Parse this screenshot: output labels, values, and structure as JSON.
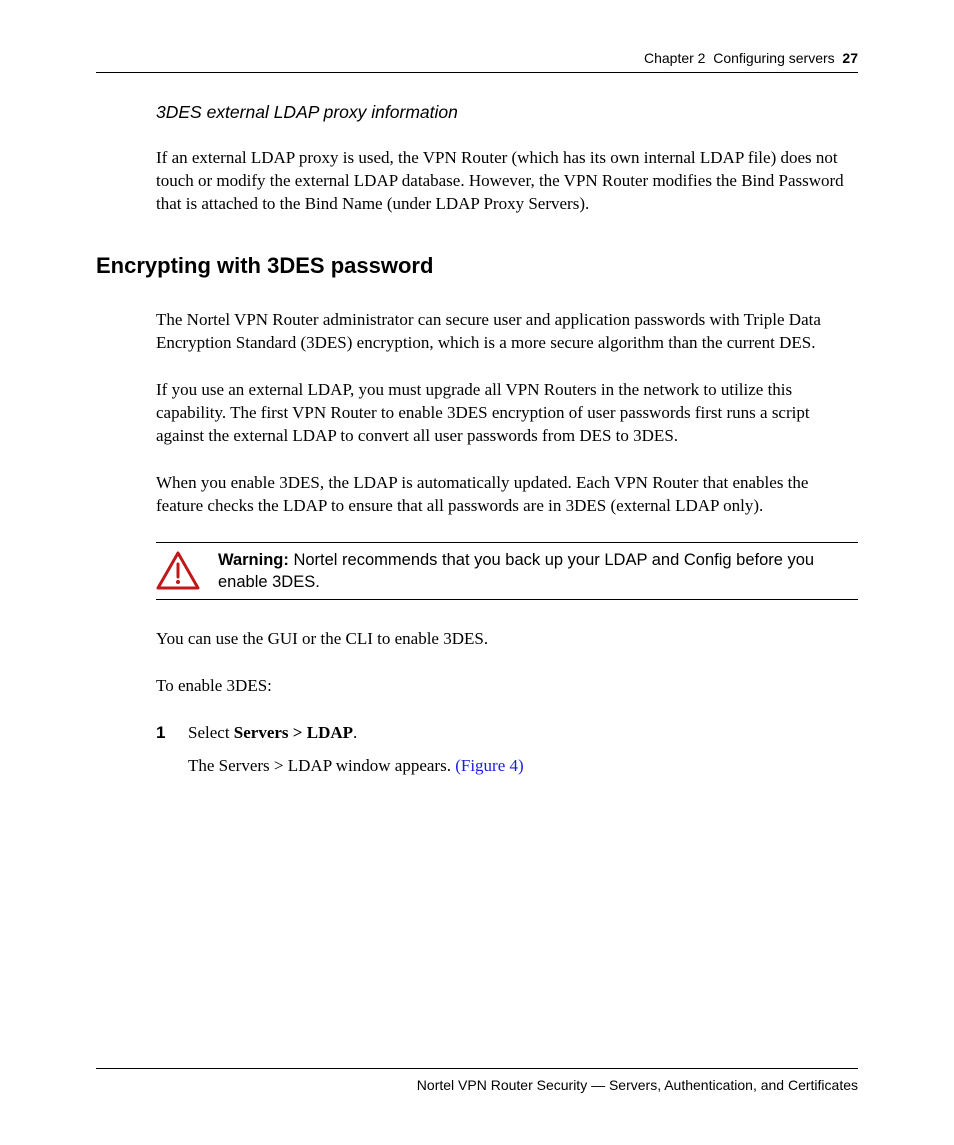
{
  "header": {
    "chapter": "Chapter 2",
    "title": "Configuring servers",
    "page_num": "27"
  },
  "sub_heading": "3DES external LDAP proxy information",
  "p_ldap_proxy": "If an external LDAP proxy is used, the VPN Router (which has its own internal LDAP file) does not touch or modify the external LDAP database. However, the VPN Router modifies the Bind Password that is attached to the Bind Name (under LDAP Proxy Servers).",
  "section_heading": "Encrypting with 3DES password",
  "p_intro": "The Nortel VPN Router administrator can secure user and application passwords with Triple Data Encryption Standard (3DES) encryption, which is a more secure algorithm than the current DES.",
  "p_upgrade": "If you use an external LDAP, you must upgrade all VPN Routers in the network to utilize this capability. The first VPN Router to enable 3DES encryption of user passwords first runs a script against the external LDAP to convert all user passwords from DES to 3DES.",
  "p_enable": "When you enable 3DES, the LDAP is automatically updated. Each VPN Router that enables the feature checks the LDAP to ensure that all passwords are in 3DES (external LDAP only).",
  "warning": {
    "label": "Warning:",
    "text": " Nortel recommends that you back up your LDAP and Config before you enable 3DES."
  },
  "p_gui_cli": "You can use the GUI or the CLI to enable 3DES.",
  "p_to_enable": "To enable 3DES:",
  "step": {
    "num": "1",
    "select_prefix": "Select ",
    "select_bold": "Servers > LDAP",
    "select_suffix": ".",
    "result_prefix": "The Servers > LDAP window appears. ",
    "figure_ref": "(Figure 4)"
  },
  "footer": "Nortel VPN Router Security — Servers, Authentication, and Certificates"
}
